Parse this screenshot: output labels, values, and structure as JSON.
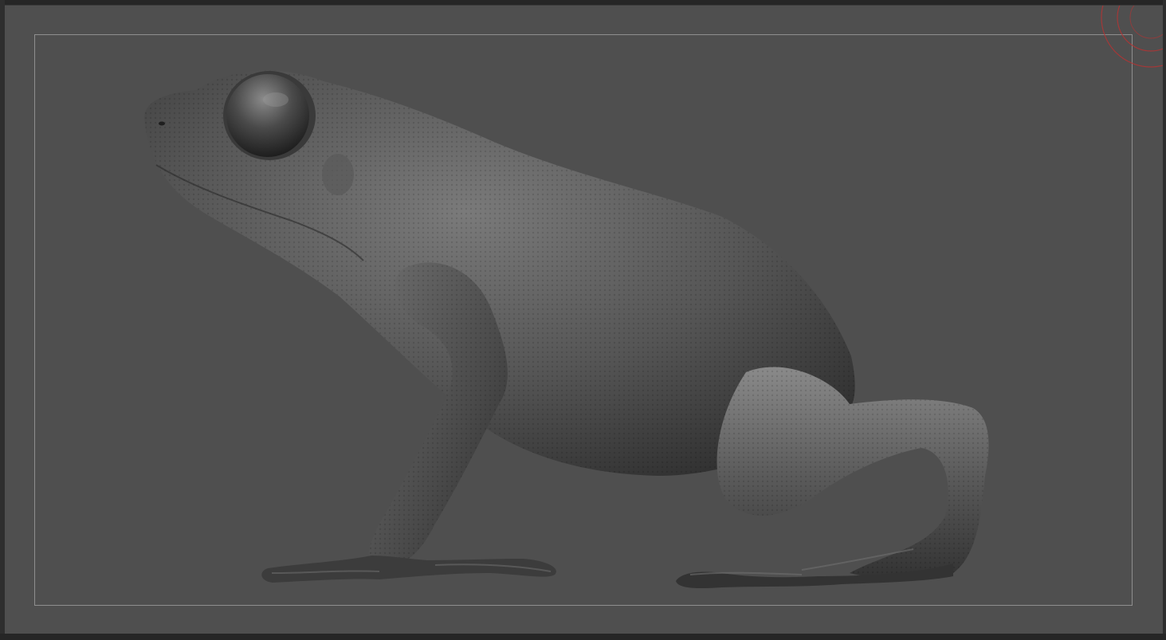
{
  "viewport": {
    "background_color": "#4f4f4f",
    "safe_frame_color": "#8e8e8e",
    "model": {
      "subject": "frog-sculpt",
      "material": "matcap-gray"
    },
    "gizmo": {
      "icon": "orbit-gizmo-icon",
      "color": "#b83232"
    }
  }
}
